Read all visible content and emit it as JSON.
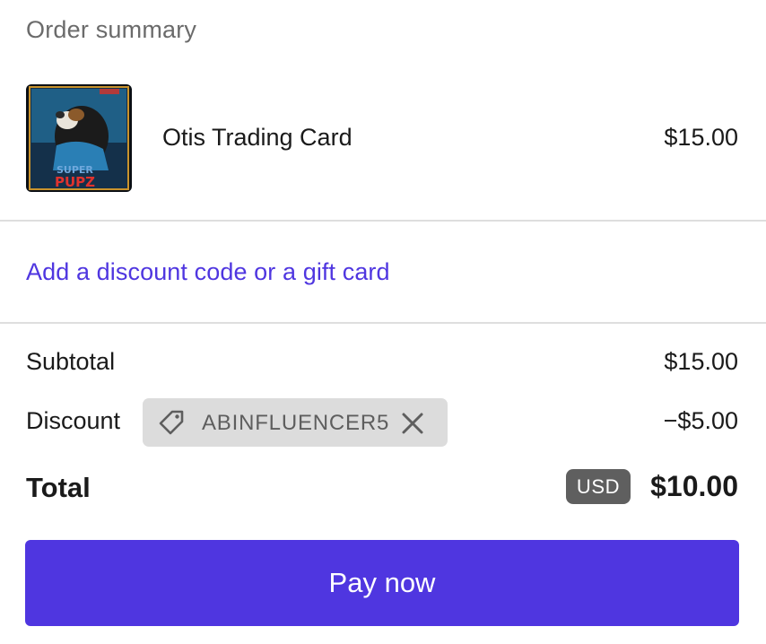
{
  "summary": {
    "title": "Order summary"
  },
  "product": {
    "name": "Otis Trading Card",
    "price": "$15.00",
    "image_icon": "trading-card-image",
    "card_text_line1": "SUPER",
    "card_text_line2": "PUPZ"
  },
  "discount_link": {
    "label": "Add a discount code or a gift card"
  },
  "lines": {
    "subtotal_label": "Subtotal",
    "subtotal_value": "$15.00",
    "discount_label": "Discount",
    "discount_value": "−$5.00"
  },
  "discount_chip": {
    "code": "ABINFLUENCER5",
    "tag_icon": "tag-icon",
    "close_icon": "close-icon"
  },
  "total": {
    "label": "Total",
    "currency": "USD",
    "value": "$10.00"
  },
  "pay_button": {
    "label": "Pay now"
  },
  "colors": {
    "accent": "#4f36e0",
    "muted_text": "#6b6b6b",
    "chip_bg": "#dcdcdc",
    "badge_bg": "#5f5f5f"
  }
}
